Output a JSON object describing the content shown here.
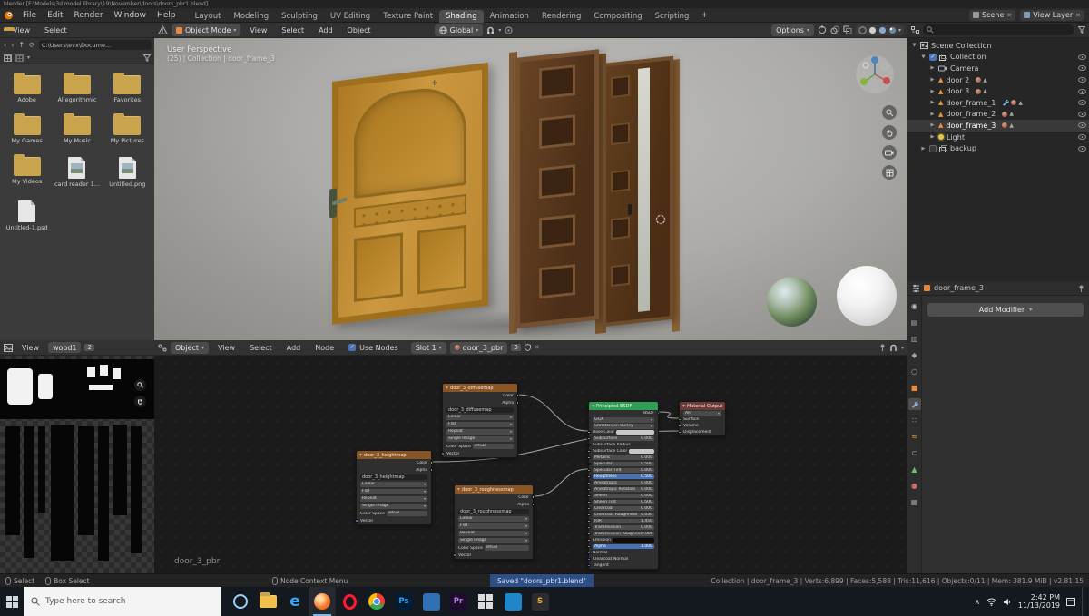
{
  "window": {
    "title": "blender  [F:\\Models\\3d model library\\19\\November\\doors\\doors_pbr1.blend]"
  },
  "menubar": {
    "menus": [
      "File",
      "Edit",
      "Render",
      "Window",
      "Help"
    ],
    "workspaces": [
      "Layout",
      "Modeling",
      "Sculpting",
      "UV Editing",
      "Texture Paint",
      "Shading",
      "Animation",
      "Rendering",
      "Compositing",
      "Scripting"
    ],
    "active_workspace": "Shading",
    "add_tab": "+",
    "scene": {
      "label": "Scene"
    },
    "view_layer": {
      "label": "View Layer"
    }
  },
  "file_browser": {
    "menus": [
      "View",
      "Select"
    ],
    "path": "C:\\Users\\evx\\Docume...",
    "items": [
      {
        "label": "Adobe",
        "type": "folder"
      },
      {
        "label": "Allegorithmic",
        "type": "folder"
      },
      {
        "label": "Favorites",
        "type": "folder"
      },
      {
        "label": "My Games",
        "type": "folder"
      },
      {
        "label": "My Music",
        "type": "folder"
      },
      {
        "label": "My Pictures",
        "type": "folder"
      },
      {
        "label": "My Videos",
        "type": "folder"
      },
      {
        "label": "card reader 1...",
        "type": "image"
      },
      {
        "label": "Untitled.png",
        "type": "image"
      },
      {
        "label": "Untitled-1.psd",
        "type": "file"
      }
    ]
  },
  "viewport": {
    "header": {
      "mode": "Object Mode",
      "menus": [
        "View",
        "Select",
        "Add",
        "Object"
      ],
      "orientation": "Global",
      "options": "Options"
    },
    "overlay": {
      "line1": "User Perspective",
      "line2": "(25) | Collection | door_frame_3"
    }
  },
  "outliner": {
    "items": [
      {
        "label": "Scene Collection",
        "depth": 0,
        "icon": "scene",
        "expand": "▼"
      },
      {
        "label": "Collection",
        "depth": 1,
        "icon": "collection",
        "checkbox": "on",
        "expand": "▼"
      },
      {
        "label": "Camera",
        "depth": 2,
        "icon": "camera",
        "expand": "▶"
      },
      {
        "label": "door 2",
        "depth": 2,
        "icon": "mesh",
        "expand": "▶",
        "badges": [
          "material",
          "mesh"
        ]
      },
      {
        "label": "door 3",
        "depth": 2,
        "icon": "mesh",
        "expand": "▶",
        "badges": [
          "material",
          "mesh"
        ]
      },
      {
        "label": "door_frame_1",
        "depth": 2,
        "icon": "mesh",
        "expand": "▶",
        "badges": [
          "modifier",
          "material",
          "mesh"
        ]
      },
      {
        "label": "door_frame_2",
        "depth": 2,
        "icon": "mesh",
        "expand": "▶",
        "badges": [
          "material",
          "mesh"
        ]
      },
      {
        "label": "door_frame_3",
        "depth": 2,
        "icon": "mesh",
        "expand": "▶",
        "badges": [
          "material",
          "mesh"
        ],
        "active": true
      },
      {
        "label": "Light",
        "depth": 2,
        "icon": "light",
        "expand": "▶"
      },
      {
        "label": "backup",
        "depth": 1,
        "icon": "collection",
        "checkbox": "off",
        "expand": "▶"
      }
    ]
  },
  "properties": {
    "breadcrumb": "door_frame_3",
    "add_modifier": "Add Modifier",
    "tabs": [
      "render",
      "output",
      "view-layer",
      "scene",
      "world",
      "object",
      "modifiers",
      "particles",
      "physics",
      "constraints",
      "object-data",
      "material",
      "texture"
    ],
    "active_tab": "modifiers"
  },
  "image_editor": {
    "menus": [
      "View"
    ],
    "image_name": "wood1",
    "users_count": "2"
  },
  "shader_editor": {
    "header": {
      "shader_type": "Object",
      "menus": [
        "View",
        "Select",
        "Add",
        "Node"
      ],
      "use_nodes": "Use Nodes",
      "slot": "Slot 1",
      "material": "door_3_pbr",
      "users_count": "3"
    },
    "canvas_label": "door_3_pbr",
    "nodes": [
      {
        "id": "tex_diffuse",
        "type": "image_texture",
        "title": "door_3_diffusemap",
        "image": "door_3_diffusemap",
        "outputs": [
          "Color",
          "Alpha"
        ],
        "dropdowns": [
          "Linear",
          "Flat",
          "Repeat",
          "Single Image"
        ],
        "color_space_label": "Color Space",
        "color_space": "sRGB",
        "inputs": [
          "Vector"
        ]
      },
      {
        "id": "tex_height",
        "type": "image_texture",
        "title": "door_3_heightmap",
        "image": "door_3_heightmap",
        "outputs": [
          "Color",
          "Alpha"
        ],
        "dropdowns": [
          "Linear",
          "Flat",
          "Repeat",
          "Single Image"
        ],
        "color_space_label": "Color Space",
        "color_space": "sRGB",
        "inputs": [
          "Vector"
        ]
      },
      {
        "id": "tex_rough",
        "type": "image_texture",
        "title": "door_3_roughnessmap",
        "image": "door_3_roughnessmap",
        "outputs": [
          "Color",
          "Alpha"
        ],
        "dropdowns": [
          "Linear",
          "Flat",
          "Repeat",
          "Single Image"
        ],
        "color_space_label": "Color Space",
        "color_space": "sRGB",
        "inputs": [
          "Vector"
        ]
      },
      {
        "id": "principled",
        "type": "shader",
        "title": "Principled BSDF",
        "outputs": [
          "BSDF"
        ],
        "params": [
          {
            "label": "GGX",
            "kind": "dropdown"
          },
          {
            "label": "Christensen-Burley",
            "kind": "dropdown"
          },
          {
            "label": "Base Color",
            "kind": "color"
          },
          {
            "label": "Subsurface",
            "value": "0.000",
            "kind": "value"
          },
          {
            "label": "Subsurface Radius",
            "kind": "socket"
          },
          {
            "label": "Subsurface Color",
            "kind": "color"
          },
          {
            "label": "Metallic",
            "value": "0.000",
            "kind": "value"
          },
          {
            "label": "Specular",
            "value": "0.500",
            "kind": "value"
          },
          {
            "label": "Specular Tint",
            "value": "0.000",
            "kind": "value"
          },
          {
            "label": "Roughness",
            "value": "0.500",
            "kind": "value",
            "highlight": true
          },
          {
            "label": "Anisotropic",
            "value": "0.000",
            "kind": "value"
          },
          {
            "label": "Anisotropic Rotation",
            "value": "0.000",
            "kind": "value"
          },
          {
            "label": "Sheen",
            "value": "0.000",
            "kind": "value"
          },
          {
            "label": "Sheen Tint",
            "value": "0.500",
            "kind": "value"
          },
          {
            "label": "Clearcoat",
            "value": "0.000",
            "kind": "value"
          },
          {
            "label": "Clearcoat Roughness",
            "value": "0.030",
            "kind": "value"
          },
          {
            "label": "IOR",
            "value": "1.450",
            "kind": "value"
          },
          {
            "label": "Transmission",
            "value": "0.000",
            "kind": "value"
          },
          {
            "label": "Transmission Roughness",
            "value": "0.000",
            "kind": "value"
          },
          {
            "label": "Emission",
            "kind": "color",
            "dark": true
          },
          {
            "label": "Alpha",
            "value": "1.000",
            "kind": "value",
            "highlight": true
          },
          {
            "label": "Normal",
            "kind": "socket"
          },
          {
            "label": "Clearcoat Normal",
            "kind": "socket"
          },
          {
            "label": "Tangent",
            "kind": "socket"
          }
        ]
      },
      {
        "id": "output",
        "type": "output",
        "title": "Material Output",
        "dropdown": "All",
        "inputs": [
          "Surface",
          "Volume",
          "Displacement"
        ]
      }
    ],
    "links": [
      {
        "from": "door_3_diffusemap.Color",
        "to": "Principled BSDF.Base Color"
      },
      {
        "from": "door_3_roughnessmap.Color",
        "to": "Principled BSDF.Roughness"
      },
      {
        "from": "door_3_heightmap.Color",
        "to": "Material Output.Displacement"
      },
      {
        "from": "Principled BSDF.BSDF",
        "to": "Material Output.Surface"
      }
    ]
  },
  "status_bar": {
    "left": [
      {
        "label": "Select"
      },
      {
        "label": "Box Select"
      }
    ],
    "context": "Node Context Menu",
    "message": "Saved \"doors_pbr1.blend\"",
    "stats": "Collection | door_frame_3 | Verts:6,899 | Faces:5,588 | Tris:11,616 | Objects:0/11 | Mem: 381.9 MiB | v2.81.15"
  },
  "taskbar": {
    "search_placeholder": "Type here to search",
    "clock_time": "2:42 PM",
    "clock_date": "11/13/2019",
    "apps": [
      {
        "id": "cortana"
      },
      {
        "id": "file-explorer"
      },
      {
        "id": "edge",
        "glyph": "e"
      },
      {
        "id": "blender",
        "running": true
      },
      {
        "id": "opera"
      },
      {
        "id": "chrome"
      },
      {
        "id": "photoshop",
        "glyph": "Ps"
      },
      {
        "id": "app-blue"
      },
      {
        "id": "premiere",
        "glyph": "Pr"
      },
      {
        "id": "app-grid"
      },
      {
        "id": "app-teal"
      },
      {
        "id": "sublime",
        "glyph": "S"
      }
    ]
  }
}
